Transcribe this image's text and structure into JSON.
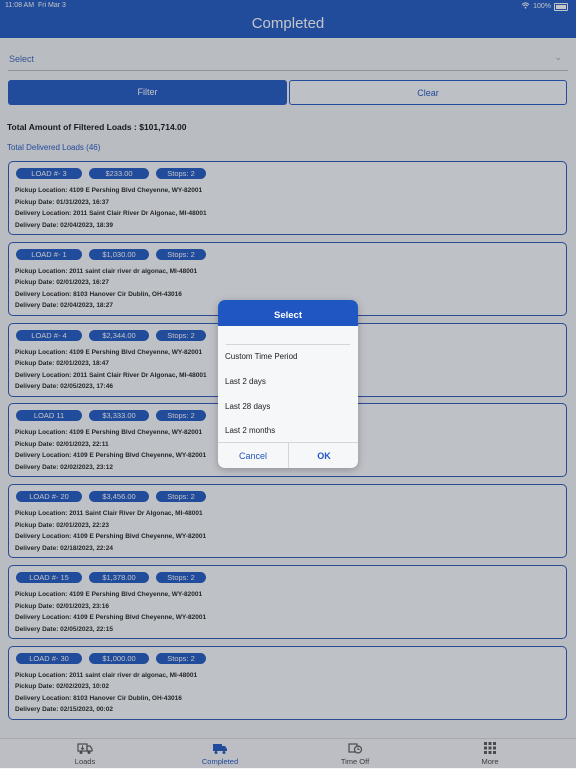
{
  "status_bar": {
    "time": "11:08 AM",
    "date": "Fri Mar 3",
    "battery": "100%"
  },
  "header": {
    "title": "Completed"
  },
  "select": {
    "placeholder": "Select",
    "icon": "chevron-down-icon"
  },
  "buttons": {
    "filter": "Filter",
    "clear": "Clear"
  },
  "summary": {
    "total_amount": "Total Amount of Filtered Loads : $101,714.00",
    "total_delivered": "Total Delivered Loads (46)"
  },
  "labels": {
    "pickup_location": "Pickup Location:",
    "pickup_date": "Pickup Date:",
    "delivery_location": "Delivery Location:",
    "delivery_date": "Delivery Date:"
  },
  "loads": [
    {
      "load": "LOAD #- 3",
      "amount": "$233.00",
      "stops": "Stops: 2",
      "pickup_location": "4109 E Pershing Blvd Cheyenne, WY-82001",
      "pickup_date": "01/31/2023, 16:37",
      "delivery_location": "2011 Saint Clair River Dr Algonac, MI-48001",
      "delivery_date": "02/04/2023, 18:39"
    },
    {
      "load": "LOAD #- 1",
      "amount": "$1,030.00",
      "stops": "Stops: 2",
      "pickup_location": "2011 saint clair river dr algonac, MI-48001",
      "pickup_date": "02/01/2023, 16:27",
      "delivery_location": "8103 Hanover Cir Dublin, OH-43016",
      "delivery_date": "02/04/2023, 18:27"
    },
    {
      "load": "LOAD #- 4",
      "amount": "$2,344.00",
      "stops": "Stops: 2",
      "pickup_location": "4109 E Pershing Blvd Cheyenne, WY-82001",
      "pickup_date": "02/01/2023, 18:47",
      "delivery_location": "2011 Saint Clair River Dr Algonac, MI-48001",
      "delivery_date": "02/05/2023, 17:46"
    },
    {
      "load": "LOAD 11",
      "amount": "$3,333.00",
      "stops": "Stops: 2",
      "pickup_location": "4109 E Pershing Blvd Cheyenne, WY-82001",
      "pickup_date": "02/01/2023, 22:11",
      "delivery_location": "4109 E Pershing Blvd Cheyenne, WY-82001",
      "delivery_date": "02/02/2023, 23:12"
    },
    {
      "load": "LOAD #- 20",
      "amount": "$3,456.00",
      "stops": "Stops: 2",
      "pickup_location": "2011 Saint Clair River Dr Algonac, MI-48001",
      "pickup_date": "02/01/2023, 22:23",
      "delivery_location": "4109 E Pershing Blvd Cheyenne, WY-82001",
      "delivery_date": "02/18/2023, 22:24"
    },
    {
      "load": "LOAD #- 15",
      "amount": "$1,378.00",
      "stops": "Stops: 2",
      "pickup_location": "4109 E Pershing Blvd Cheyenne, WY-82001",
      "pickup_date": "02/01/2023, 23:16",
      "delivery_location": "4109 E Pershing Blvd Cheyenne, WY-82001",
      "delivery_date": "02/05/2023, 22:15"
    },
    {
      "load": "LOAD #- 30",
      "amount": "$1,000.00",
      "stops": "Stops: 2",
      "pickup_location": "2011 saint clair river dr algonac, MI-48001",
      "pickup_date": "02/02/2023, 10:02",
      "delivery_location": "8103 Hanover Cir Dublin, OH-43016",
      "delivery_date": "02/15/2023, 00:02"
    }
  ],
  "tabs": [
    {
      "label": "Loads",
      "icon": "truck-icon",
      "active": false
    },
    {
      "label": "Completed",
      "icon": "completed-truck-icon",
      "active": true
    },
    {
      "label": "Time Off",
      "icon": "time-off-icon",
      "active": false
    },
    {
      "label": "More",
      "icon": "grid-icon",
      "active": false
    }
  ],
  "dialog": {
    "title": "Select",
    "options": [
      "Custom Time Period",
      "Last 2 days",
      "Last 28 days",
      "Last 2 months"
    ],
    "cancel": "Cancel",
    "ok": "OK"
  },
  "colors": {
    "primary": "#1f56c1",
    "background": "#f2f3f5",
    "overlay": "rgba(40,46,58,0.28)"
  }
}
